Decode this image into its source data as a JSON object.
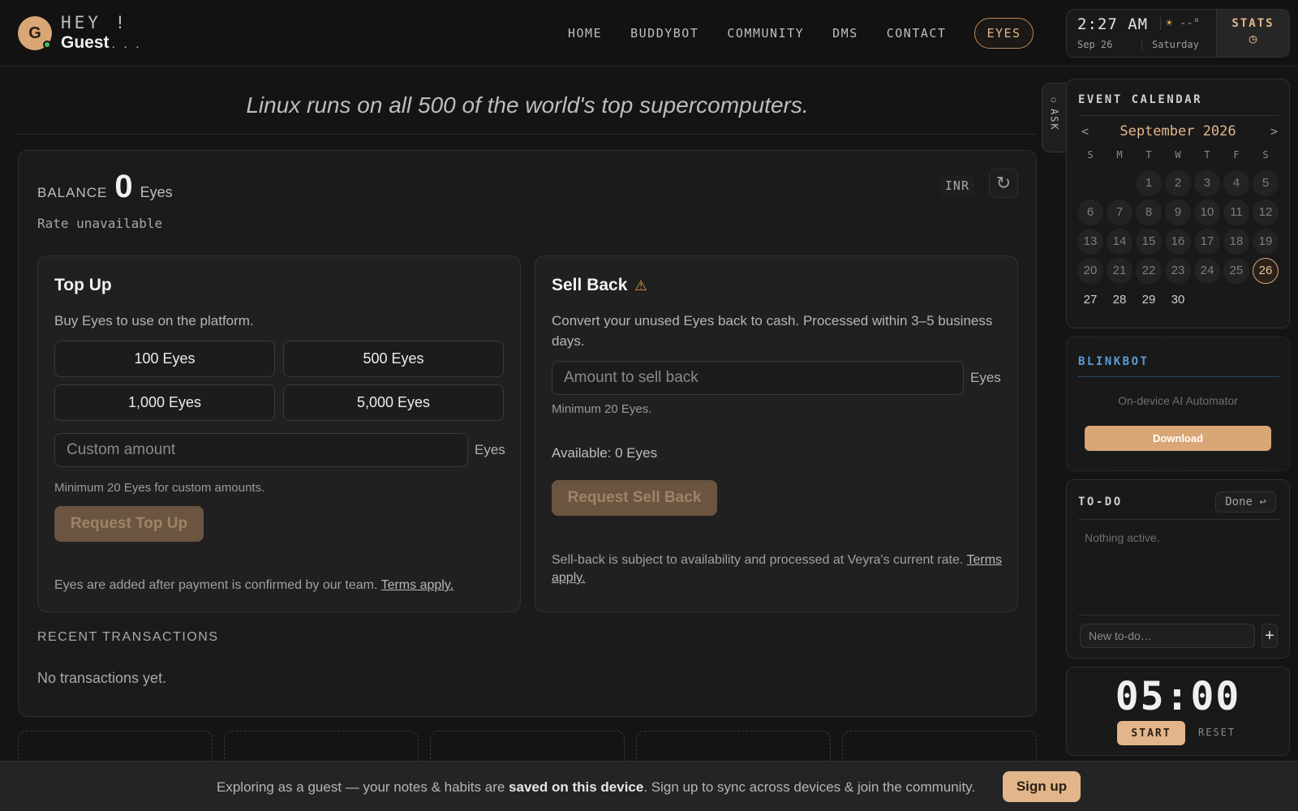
{
  "header": {
    "avatar_initial": "G",
    "greeting": "HEY !",
    "user_name": "Guest",
    "user_dots": ". . .",
    "nav": [
      {
        "label": "HOME",
        "active": false
      },
      {
        "label": "BUDDYBOT",
        "active": false
      },
      {
        "label": "COMMUNITY",
        "active": false
      },
      {
        "label": "DMS",
        "active": false
      },
      {
        "label": "CONTACT",
        "active": false
      },
      {
        "label": "EYES",
        "active": true
      }
    ],
    "clock": {
      "time": "2:27 AM",
      "weather_icon": "sun-icon",
      "weather": "--°",
      "date": "Sep 26",
      "day": "Saturday",
      "stats_label": "STATS",
      "stats_icon": "pie-chart-icon"
    }
  },
  "fact": "Linux runs on all 500 of the world's top supercomputers.",
  "wallet": {
    "balance_label": "BALANCE",
    "balance_value": "0",
    "balance_unit": "Eyes",
    "rate": "Rate unavailable",
    "currency": "INR",
    "refresh_icon": "refresh-icon",
    "topup": {
      "title": "Top Up",
      "desc": "Buy Eyes to use on the platform.",
      "packages": [
        "100 Eyes",
        "500 Eyes",
        "1,000 Eyes",
        "5,000 Eyes"
      ],
      "custom_placeholder": "Custom amount",
      "unit": "Eyes",
      "hint": "Minimum 20 Eyes for custom amounts.",
      "button": "Request Top Up",
      "footer": "Eyes are added after payment is confirmed by our team.",
      "footer_link": "Terms apply."
    },
    "sellback": {
      "title": "Sell Back",
      "warn_icon": "warning-icon",
      "desc": "Convert your unused Eyes back to cash. Processed within 3–5 business days.",
      "amount_placeholder": "Amount to sell back",
      "unit": "Eyes",
      "hint": "Minimum 20 Eyes.",
      "available": "Available: 0 Eyes",
      "button": "Request Sell Back",
      "footer": "Sell-back is subject to availability and processed at Veyra's current rate.",
      "footer_link": "Terms apply."
    },
    "recent_title": "RECENT TRANSACTIONS",
    "recent_empty": "No transactions yet."
  },
  "ask_label": "ASK",
  "calendar": {
    "title": "EVENT CALENDAR",
    "prev": "<",
    "next": ">",
    "month": "September 2026",
    "dow": [
      "S",
      "M",
      "T",
      "W",
      "T",
      "F",
      "S"
    ],
    "first_weekday": 2,
    "days_in_month": 30,
    "today": 26
  },
  "blinkbot": {
    "title": "BLINKBOT",
    "subtitle": "On-device AI Automator",
    "button": "Download"
  },
  "todo": {
    "title": "TO-DO",
    "done_label": "Done",
    "done_icon": "return-icon",
    "empty": "Nothing active.",
    "placeholder": "New to-do…",
    "add": "+"
  },
  "timer": {
    "display": "05:00",
    "start": "START",
    "reset": "RESET"
  },
  "guestbar": {
    "msg_pre": "Exploring as a guest — your notes & habits are ",
    "msg_bold": "saved on this device",
    "msg_post": ". Sign up to sync across devices & join the community.",
    "signup": "Sign up"
  }
}
